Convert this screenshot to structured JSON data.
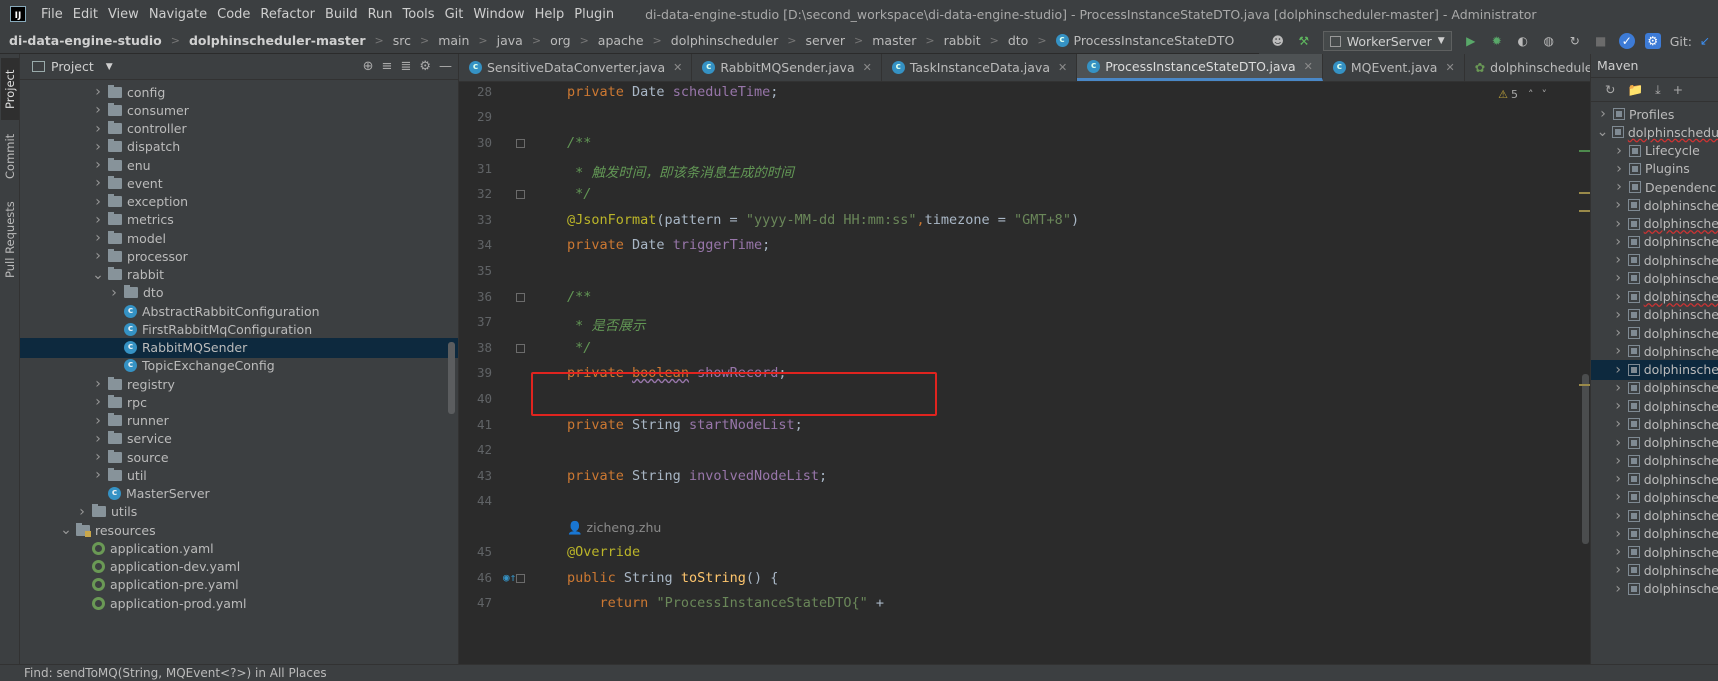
{
  "menubar": {
    "items": [
      "File",
      "Edit",
      "View",
      "Navigate",
      "Code",
      "Refactor",
      "Build",
      "Run",
      "Tools",
      "Git",
      "Window",
      "Help",
      "Plugin"
    ],
    "window_title": "di-data-engine-studio [D:\\second_workspace\\di-data-engine-studio] - ProcessInstanceStateDTO.java [dolphinscheduler-master] - Administrator"
  },
  "breadcrumbs": [
    "di-data-engine-studio",
    "dolphinscheduler-master",
    "src",
    "main",
    "java",
    "org",
    "apache",
    "dolphinscheduler",
    "server",
    "master",
    "rabbit",
    "dto",
    "ProcessInstanceStateDTO"
  ],
  "run_toolbar": {
    "config": "WorkerServer",
    "git_label": "Git:"
  },
  "left_strip": {
    "tabs": [
      "Project",
      "Commit",
      "Pull Requests"
    ]
  },
  "project_panel": {
    "title": "Project",
    "tree": [
      {
        "label": "config",
        "type": "folder",
        "depth": 3,
        "expanded": false
      },
      {
        "label": "consumer",
        "type": "folder",
        "depth": 3,
        "expanded": false
      },
      {
        "label": "controller",
        "type": "folder",
        "depth": 3,
        "expanded": false
      },
      {
        "label": "dispatch",
        "type": "folder",
        "depth": 3,
        "expanded": false
      },
      {
        "label": "enu",
        "type": "folder",
        "depth": 3,
        "expanded": false
      },
      {
        "label": "event",
        "type": "folder",
        "depth": 3,
        "expanded": false
      },
      {
        "label": "exception",
        "type": "folder",
        "depth": 3,
        "expanded": false
      },
      {
        "label": "metrics",
        "type": "folder",
        "depth": 3,
        "expanded": false
      },
      {
        "label": "model",
        "type": "folder",
        "depth": 3,
        "expanded": false
      },
      {
        "label": "processor",
        "type": "folder",
        "depth": 3,
        "expanded": false
      },
      {
        "label": "rabbit",
        "type": "folder",
        "depth": 3,
        "expanded": true
      },
      {
        "label": "dto",
        "type": "folder",
        "depth": 4,
        "expanded": false
      },
      {
        "label": "AbstractRabbitConfiguration",
        "type": "class",
        "depth": 4
      },
      {
        "label": "FirstRabbitMqConfiguration",
        "type": "class",
        "depth": 4
      },
      {
        "label": "RabbitMQSender",
        "type": "class",
        "depth": 4,
        "selected": true
      },
      {
        "label": "TopicExchangeConfig",
        "type": "class",
        "depth": 4
      },
      {
        "label": "registry",
        "type": "folder",
        "depth": 3,
        "expanded": false
      },
      {
        "label": "rpc",
        "type": "folder",
        "depth": 3,
        "expanded": false
      },
      {
        "label": "runner",
        "type": "folder",
        "depth": 3,
        "expanded": false
      },
      {
        "label": "service",
        "type": "folder",
        "depth": 3,
        "expanded": false
      },
      {
        "label": "source",
        "type": "folder",
        "depth": 3,
        "expanded": false
      },
      {
        "label": "util",
        "type": "folder",
        "depth": 3,
        "expanded": false
      },
      {
        "label": "MasterServer",
        "type": "main-class",
        "depth": 3
      },
      {
        "label": "utils",
        "type": "folder",
        "depth": 2,
        "expanded": false
      },
      {
        "label": "resources",
        "type": "res-folder",
        "depth": 1,
        "expanded": true
      },
      {
        "label": "application.yaml",
        "type": "yaml",
        "depth": 2
      },
      {
        "label": "application-dev.yaml",
        "type": "yaml",
        "depth": 2
      },
      {
        "label": "application-pre.yaml",
        "type": "yaml",
        "depth": 2
      },
      {
        "label": "application-prod.yaml",
        "type": "yaml",
        "depth": 2
      }
    ]
  },
  "editor": {
    "tabs": [
      {
        "label": "SensitiveDataConverter.java",
        "active": false
      },
      {
        "label": "RabbitMQSender.java",
        "active": false
      },
      {
        "label": "TaskInstanceData.java",
        "active": false
      },
      {
        "label": "ProcessInstanceStateDTO.java",
        "active": true
      },
      {
        "label": "MQEvent.java",
        "active": false
      },
      {
        "label": "dolphinscheduler-mas",
        "active": false
      }
    ],
    "inspection_count": "5",
    "lines": [
      {
        "num": "28",
        "text": "private Date scheduleTime;"
      },
      {
        "num": "29",
        "text": ""
      },
      {
        "num": "30",
        "text": "/**"
      },
      {
        "num": "31",
        "text": " * 触发时间，即该条消息生成的时间"
      },
      {
        "num": "32",
        "text": " */"
      },
      {
        "num": "33",
        "text": "@JsonFormat(pattern = \"yyyy-MM-dd HH:mm:ss\",timezone = \"GMT+8\")"
      },
      {
        "num": "34",
        "text": "private Date triggerTime;"
      },
      {
        "num": "35",
        "text": ""
      },
      {
        "num": "36",
        "text": "/**"
      },
      {
        "num": "37",
        "text": " * 是否展示"
      },
      {
        "num": "38",
        "text": " */"
      },
      {
        "num": "39",
        "text": "private boolean showRecord;"
      },
      {
        "num": "40",
        "text": ""
      },
      {
        "num": "41",
        "text": "private String startNodeList;"
      },
      {
        "num": "42",
        "text": ""
      },
      {
        "num": "43",
        "text": "private String involvedNodeList;"
      },
      {
        "num": "44",
        "text": ""
      },
      {
        "num": "",
        "text": "zicheng.zhu"
      },
      {
        "num": "45",
        "text": "@Override"
      },
      {
        "num": "46",
        "text": "public String toString() {"
      },
      {
        "num": "47",
        "text": "    return \"ProcessInstanceStateDTO{\" +"
      }
    ]
  },
  "maven_panel": {
    "title": "Maven",
    "items": [
      {
        "label": "Profiles",
        "depth": 0
      },
      {
        "label": "dolphinschedu",
        "depth": 0,
        "expanded": true,
        "squiggle": true
      },
      {
        "label": "Lifecycle",
        "depth": 1
      },
      {
        "label": "Plugins",
        "depth": 1
      },
      {
        "label": "Dependenc",
        "depth": 1
      },
      {
        "label": "dolphinsche",
        "depth": 1
      },
      {
        "label": "dolphinsche",
        "depth": 1,
        "squiggle": true
      },
      {
        "label": "dolphinsche",
        "depth": 1
      },
      {
        "label": "dolphinsche",
        "depth": 1
      },
      {
        "label": "dolphinsche",
        "depth": 1
      },
      {
        "label": "dolphinsche",
        "depth": 1,
        "squiggle": true
      },
      {
        "label": "dolphinsche",
        "depth": 1
      },
      {
        "label": "dolphinsche",
        "depth": 1
      },
      {
        "label": "dolphinsche",
        "depth": 1
      },
      {
        "label": "dolphinsche",
        "depth": 1,
        "selected": true
      },
      {
        "label": "dolphinsche",
        "depth": 1
      },
      {
        "label": "dolphinsche",
        "depth": 1
      },
      {
        "label": "dolphinsche",
        "depth": 1
      },
      {
        "label": "dolphinsche",
        "depth": 1
      },
      {
        "label": "dolphinsche",
        "depth": 1
      },
      {
        "label": "dolphinsche",
        "depth": 1
      },
      {
        "label": "dolphinsche",
        "depth": 1
      },
      {
        "label": "dolphinsche",
        "depth": 1
      },
      {
        "label": "dolphinsche",
        "depth": 1
      },
      {
        "label": "dolphinsche",
        "depth": 1
      },
      {
        "label": "dolphinsche",
        "depth": 1
      },
      {
        "label": "dolphinsche",
        "depth": 1
      }
    ]
  },
  "status": {
    "find_text": "Find:    sendToMQ(String, MQEvent<?>) in All Places"
  },
  "colors": {
    "accent": "#4a88c7",
    "highlight_box": "#e0241f",
    "selection": "#0d293e",
    "keyword": "#cc7832",
    "field": "#9876aa",
    "comment": "#629755",
    "string": "#6a8759"
  }
}
